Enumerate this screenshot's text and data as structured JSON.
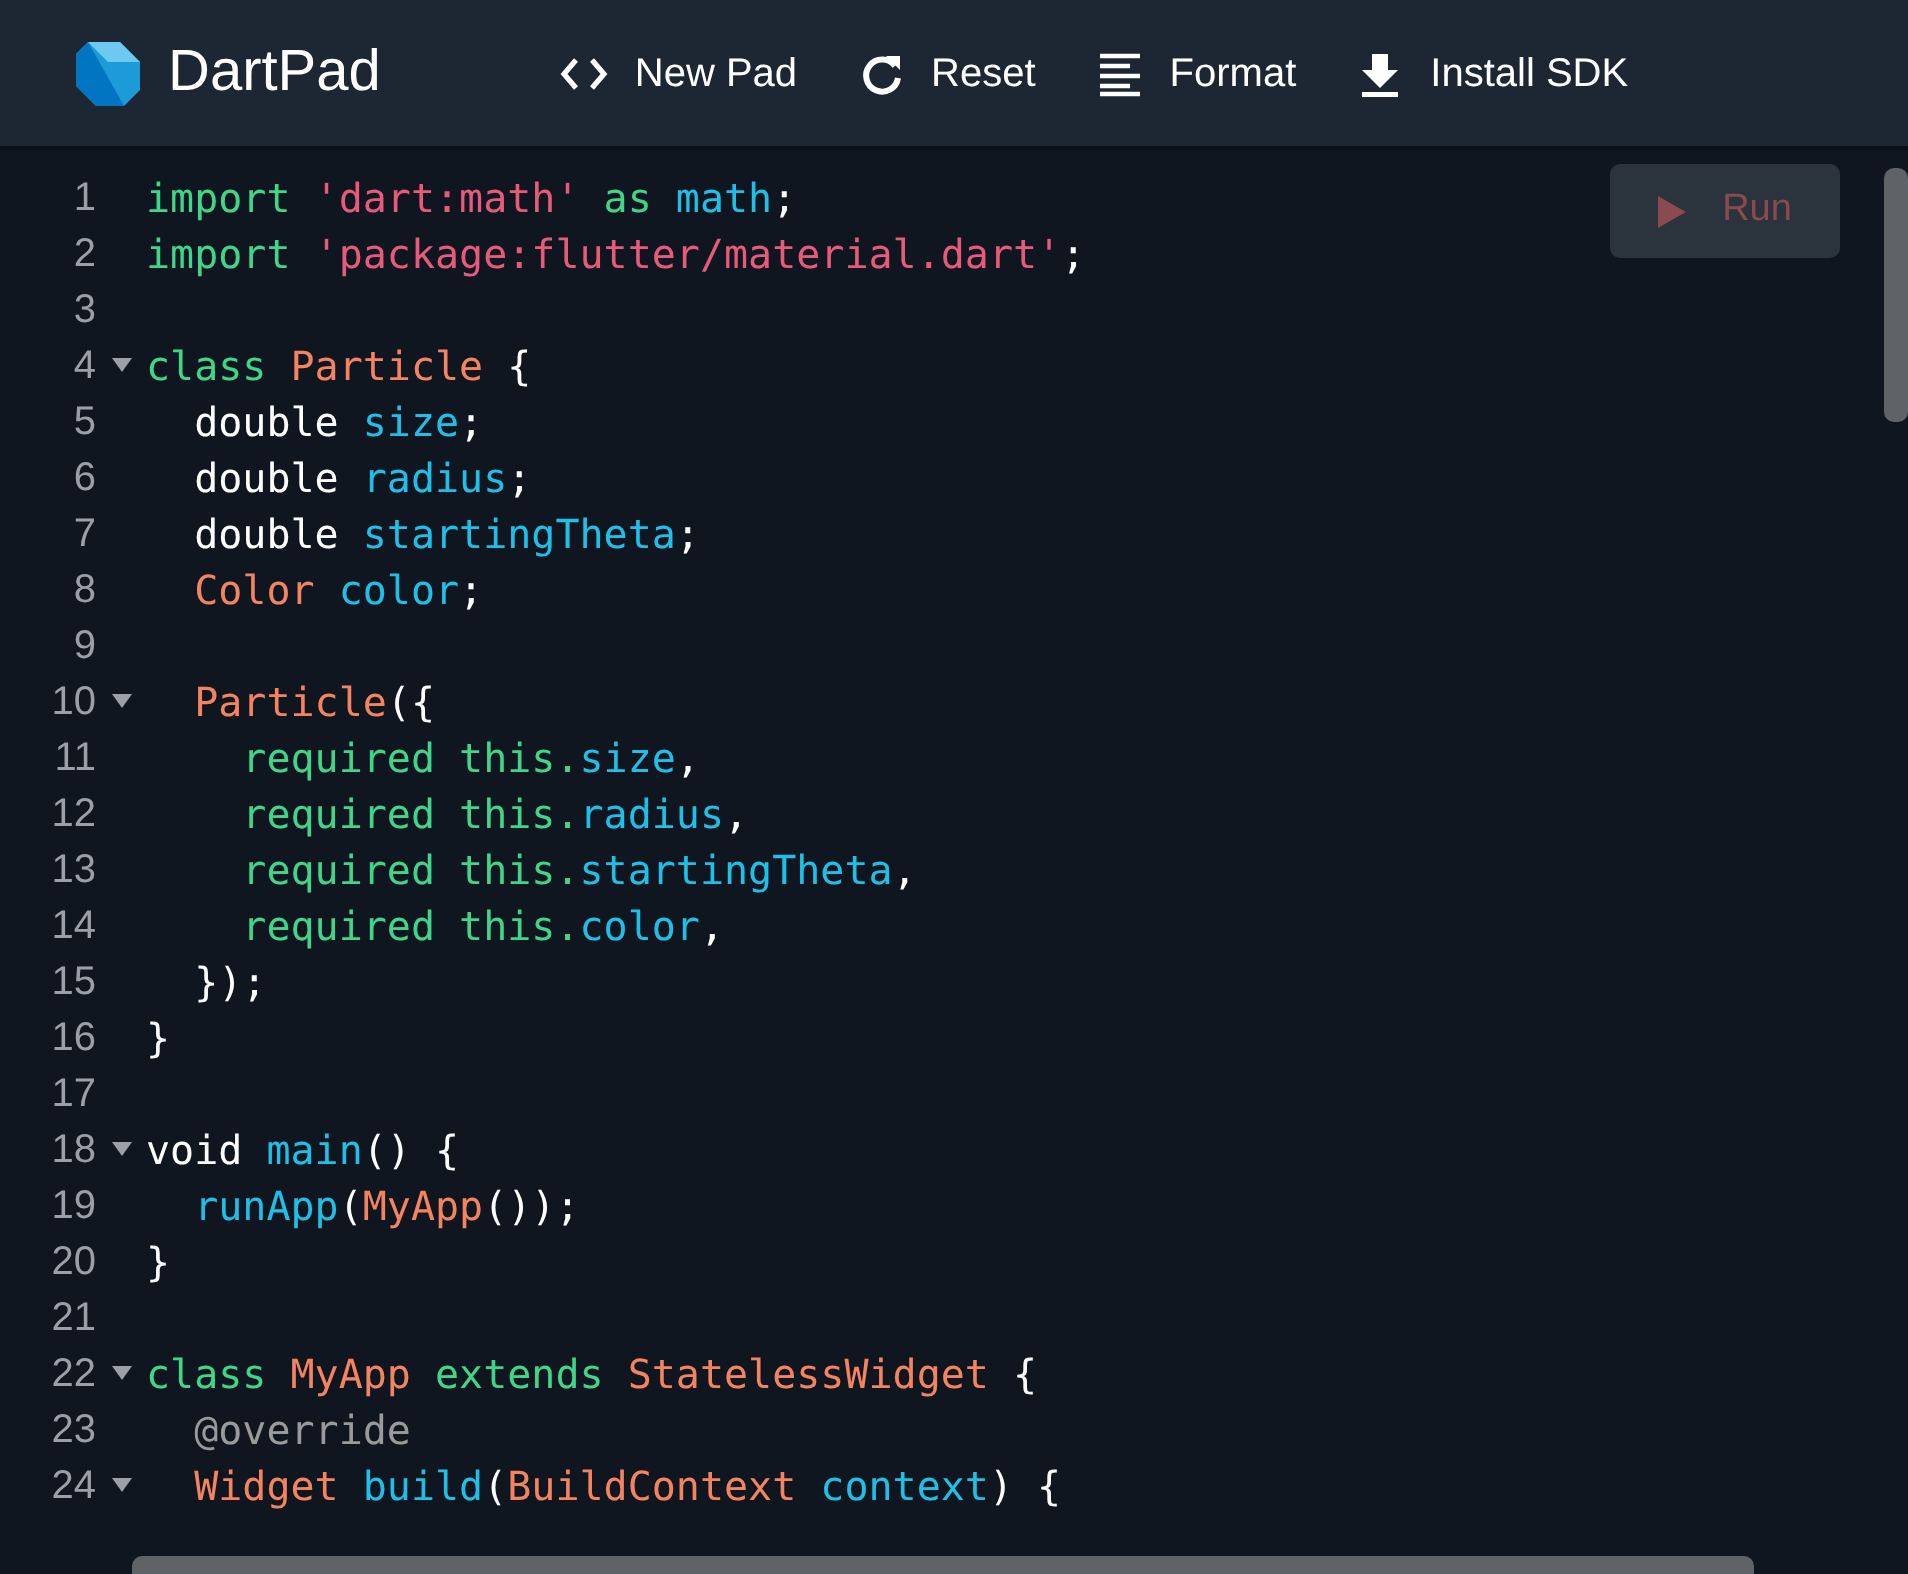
{
  "header": {
    "title": "DartPad",
    "actions": [
      {
        "label": "New Pad",
        "kind": "code"
      },
      {
        "label": "Reset",
        "kind": "refresh"
      },
      {
        "label": "Format",
        "kind": "lines"
      },
      {
        "label": "Install SDK",
        "kind": "download"
      }
    ]
  },
  "run_button": {
    "label": "Run",
    "disabled": true
  },
  "editor": {
    "lines": [
      {
        "number": "1",
        "foldable": false,
        "tokens": [
          {
            "text": "import",
            "kind": "keyword"
          },
          {
            "text": " 'dart:math'",
            "kind": "string"
          },
          {
            "text": " as",
            "kind": "keyword"
          },
          {
            "text": " math",
            "kind": "ident"
          },
          {
            "text": ";",
            "kind": "plain"
          }
        ]
      },
      {
        "number": "2",
        "foldable": false,
        "tokens": [
          {
            "text": "import",
            "kind": "keyword"
          },
          {
            "text": " 'package:flutter/material.dart'",
            "kind": "string"
          },
          {
            "text": ";",
            "kind": "plain"
          }
        ]
      },
      {
        "number": "3",
        "foldable": false
      },
      {
        "number": "4",
        "foldable": true,
        "tokens": [
          {
            "text": "class",
            "kind": "keyword"
          },
          {
            "text": " Particle",
            "kind": "type"
          },
          {
            "text": " {",
            "kind": "plain"
          }
        ]
      },
      {
        "number": "5",
        "foldable": false,
        "tokens": [
          {
            "text": "  double",
            "kind": "plain"
          },
          {
            "text": " size",
            "kind": "ident"
          },
          {
            "text": ";",
            "kind": "plain"
          }
        ]
      },
      {
        "number": "6",
        "foldable": false,
        "tokens": [
          {
            "text": "  double",
            "kind": "plain"
          },
          {
            "text": " radius",
            "kind": "ident"
          },
          {
            "text": ";",
            "kind": "plain"
          }
        ]
      },
      {
        "number": "7",
        "foldable": false,
        "tokens": [
          {
            "text": "  double",
            "kind": "plain"
          },
          {
            "text": " startingTheta",
            "kind": "ident"
          },
          {
            "text": ";",
            "kind": "plain"
          }
        ]
      },
      {
        "number": "8",
        "foldable": false,
        "tokens": [
          {
            "text": "  Color",
            "kind": "type"
          },
          {
            "text": " color",
            "kind": "ident"
          },
          {
            "text": ";",
            "kind": "plain"
          }
        ]
      },
      {
        "number": "9",
        "foldable": false
      },
      {
        "number": "10",
        "foldable": true,
        "tokens": [
          {
            "text": "  Particle",
            "kind": "type"
          },
          {
            "text": "({",
            "kind": "plain"
          }
        ]
      },
      {
        "number": "11",
        "foldable": false,
        "tokens": [
          {
            "text": "    required this.",
            "kind": "keyword"
          },
          {
            "text": "size",
            "kind": "ident"
          },
          {
            "text": ",",
            "kind": "plain"
          }
        ]
      },
      {
        "number": "12",
        "foldable": false,
        "tokens": [
          {
            "text": "    required this.",
            "kind": "keyword"
          },
          {
            "text": "radius",
            "kind": "ident"
          },
          {
            "text": ",",
            "kind": "plain"
          }
        ]
      },
      {
        "number": "13",
        "foldable": false,
        "tokens": [
          {
            "text": "    required this.",
            "kind": "keyword"
          },
          {
            "text": "startingTheta",
            "kind": "ident"
          },
          {
            "text": ",",
            "kind": "plain"
          }
        ]
      },
      {
        "number": "14",
        "foldable": false,
        "tokens": [
          {
            "text": "    required this.",
            "kind": "keyword"
          },
          {
            "text": "color",
            "kind": "ident"
          },
          {
            "text": ",",
            "kind": "plain"
          }
        ]
      },
      {
        "number": "15",
        "foldable": false,
        "tokens": [
          {
            "text": "  });",
            "kind": "plain"
          }
        ]
      },
      {
        "number": "16",
        "foldable": false,
        "tokens": [
          {
            "text": "}",
            "kind": "plain"
          }
        ]
      },
      {
        "number": "17",
        "foldable": false
      },
      {
        "number": "18",
        "foldable": true,
        "tokens": [
          {
            "text": "void",
            "kind": "plain"
          },
          {
            "text": " main",
            "kind": "ident"
          },
          {
            "text": "() {",
            "kind": "plain"
          }
        ]
      },
      {
        "number": "19",
        "foldable": false,
        "tokens": [
          {
            "text": "  runApp",
            "kind": "ident"
          },
          {
            "text": "(",
            "kind": "plain"
          },
          {
            "text": "MyApp",
            "kind": "type"
          },
          {
            "text": "());",
            "kind": "plain"
          }
        ]
      },
      {
        "number": "20",
        "foldable": false,
        "tokens": [
          {
            "text": "}",
            "kind": "plain"
          }
        ]
      },
      {
        "number": "21",
        "foldable": false
      },
      {
        "number": "22",
        "foldable": true,
        "tokens": [
          {
            "text": "class",
            "kind": "keyword"
          },
          {
            "text": " MyApp",
            "kind": "type"
          },
          {
            "text": " extends",
            "kind": "keyword"
          },
          {
            "text": " StatelessWidget",
            "kind": "type"
          },
          {
            "text": " {",
            "kind": "plain"
          }
        ]
      },
      {
        "number": "23",
        "foldable": false,
        "tokens": [
          {
            "text": "  @override",
            "kind": "meta"
          }
        ]
      },
      {
        "number": "24",
        "foldable": true,
        "tokens": [
          {
            "text": "  Widget",
            "kind": "type"
          },
          {
            "text": " build",
            "kind": "ident"
          },
          {
            "text": "(",
            "kind": "plain"
          },
          {
            "text": "BuildContext",
            "kind": "type"
          },
          {
            "text": " context",
            "kind": "ident"
          },
          {
            "text": ") {",
            "kind": "plain"
          }
        ]
      }
    ]
  }
}
